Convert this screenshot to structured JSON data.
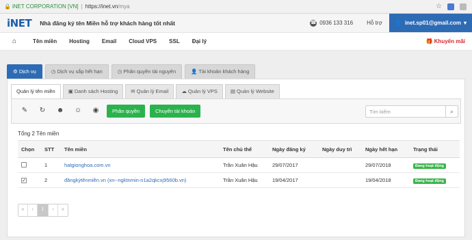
{
  "browser": {
    "secure_label": "iNET CORPORATION [VN]",
    "url_host": "https://inet.vn",
    "url_path": "/mya"
  },
  "header": {
    "logo": "iNET",
    "tagline": "Nhà đăng ký tên Miền hỗ trợ khách hàng tốt nhất",
    "phone": "0936 133 316",
    "support": "Hỗ trợ",
    "user_email": "inet.sp01@gmail.com"
  },
  "nav": {
    "items": [
      "Tên miền",
      "Hosting",
      "Email",
      "Cloud VPS",
      "SSL",
      "Đại lý"
    ],
    "promo": "Khuyến mãi"
  },
  "tabs1": [
    "Dịch vụ",
    "Dịch vụ sắp hết hạn",
    "Phân quyền tài nguyên",
    "Tài khoản khách hàng"
  ],
  "tabs2": [
    "Quản lý tên miền",
    "Danh sách Hosting",
    "Quản lý Email",
    "Quản lý VPS",
    "Quản lý Website"
  ],
  "toolbar": {
    "phanquyen": "Phân quyền",
    "chuyen": "Chuyển tài khoản",
    "search_placeholder": "Tìm kiếm"
  },
  "total": "Tổng 2 Tên miền",
  "table": {
    "headers": [
      "Chọn",
      "STT",
      "Tên miền",
      "Tên chủ thể",
      "Ngày đăng ký",
      "Ngày duy trì",
      "Ngày hết hạn",
      "Trạng thái"
    ],
    "rows": [
      {
        "checked": false,
        "stt": "1",
        "domain": "hatgionghoa.com.vn",
        "owner": "Trần Xuân Hậu",
        "reg": "29/07/2017",
        "maint": "",
        "exp": "29/07/2018",
        "status": "Đang hoạt động"
      },
      {
        "checked": true,
        "stt": "2",
        "domain": "đăngkýtênmiền.vn (xn--ngktnmin-n1a2qkcxj9560b.vn)",
        "owner": "Trần Xuân Hậu",
        "reg": "19/04/2017",
        "maint": "",
        "exp": "19/04/2018",
        "status": "Đang hoạt động"
      }
    ]
  },
  "pager": [
    "«",
    "‹",
    "1",
    "›",
    "»"
  ],
  "colors": {
    "primary": "#2e6bb5",
    "success": "#2bb24c",
    "danger": "#d9262d"
  }
}
